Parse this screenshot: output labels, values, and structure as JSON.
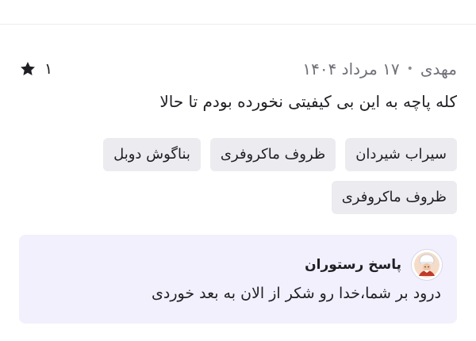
{
  "review": {
    "author": "مهدی",
    "date": "۱۷ مرداد ۱۴۰۴",
    "rating": "۱",
    "text": "کله پاچه به این بی کیفیتی نخورده بودم تا حالا"
  },
  "tags": [
    "سیراب شیردان",
    "ظروف ماکروفری",
    "بناگوش دوبل",
    "ظروف ماکروفری"
  ],
  "reply": {
    "title": "پاسخ رستوران",
    "text": "درود بر شما،خدا رو شکر از الان به بعد خوردی"
  },
  "icons": {
    "rating": "star-icon",
    "reply_avatar": "restaurant-avatar-icon"
  },
  "colors": {
    "reply_background": "#f1f0fc",
    "tag_background": "#ececf0",
    "meta_text": "#6f6f78"
  }
}
